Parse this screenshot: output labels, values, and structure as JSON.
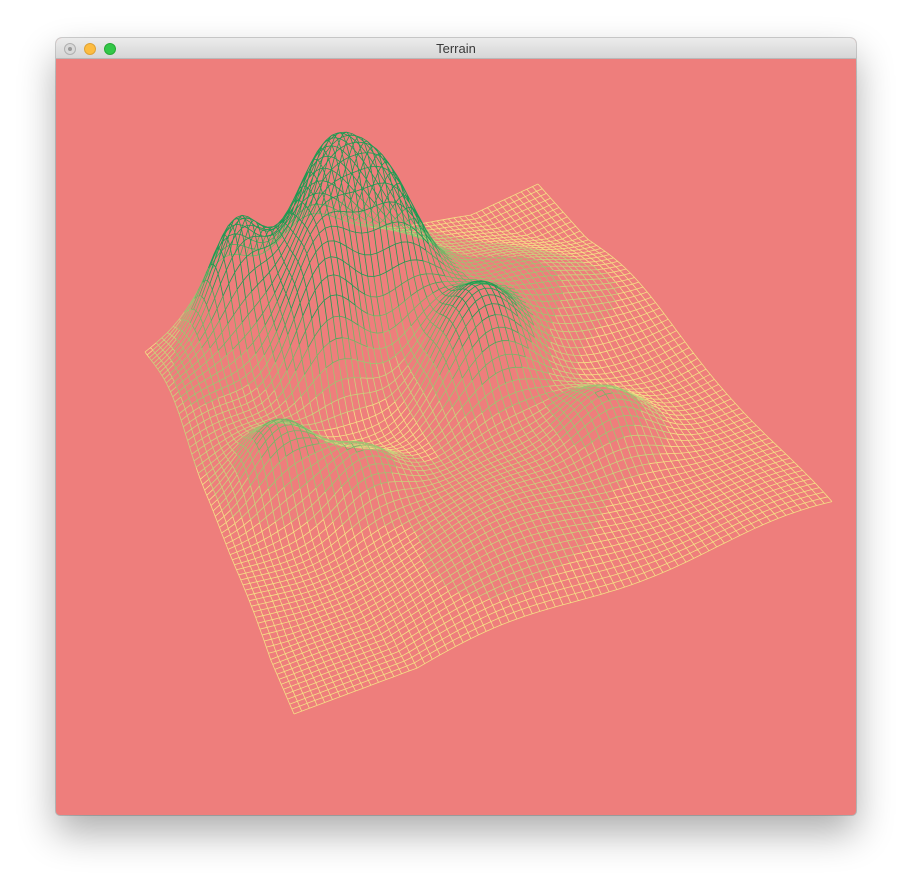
{
  "window": {
    "title": "Terrain"
  },
  "colors": {
    "background": "#ee7e7c",
    "mesh_low": "#f5df86",
    "mesh_high": "#1f9a52",
    "titlebar": "#e3e3e3"
  },
  "icons": {
    "close": "close-dot",
    "minimize": "minimize-dot",
    "maximize": "zoom-dot"
  }
}
